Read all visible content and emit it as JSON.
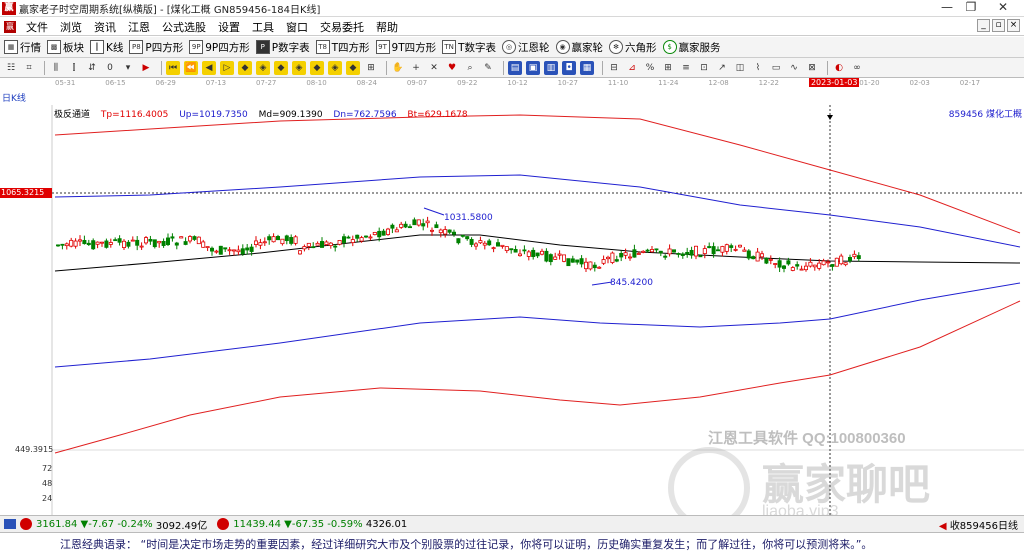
{
  "window": {
    "title": "赢家老子时空周期系统[纵横版] - [煤化工概  GN859456-184日K线]",
    "minimize": "—",
    "restore": "❐",
    "close": "✕"
  },
  "menu": {
    "items": [
      "文件",
      "浏览",
      "资讯",
      "江恩",
      "公式选股",
      "设置",
      "工具",
      "窗口",
      "交易委托",
      "帮助"
    ],
    "mdi": [
      "_",
      "▫",
      "×"
    ]
  },
  "toolbar1": {
    "items": [
      {
        "icon": "",
        "label": "行情"
      },
      {
        "icon": "",
        "label": "板块"
      },
      {
        "icon": "",
        "label": "K线"
      },
      {
        "icon": "P8",
        "label": "P四方形"
      },
      {
        "icon": "9P",
        "label": "9P四方形"
      },
      {
        "icon": "P",
        "label": "P数字表"
      },
      {
        "icon": "T8",
        "label": "T四方形"
      },
      {
        "icon": "9T",
        "label": "9T四方形"
      },
      {
        "icon": "TN",
        "label": "T数字表"
      },
      {
        "icon": "",
        "label": "江恩轮"
      },
      {
        "icon": "",
        "label": "赢家轮"
      },
      {
        "icon": "",
        "label": "六角形"
      },
      {
        "icon": "$",
        "label": "赢家服务"
      }
    ]
  },
  "toolbar2": {
    "icons": [
      "grid-icon",
      "chart-icon",
      "bar-icon",
      "candle-icon",
      "move-icon",
      "flag-icon",
      "first-icon",
      "back-icon",
      "prev-icon",
      "next-icon",
      "diamond-icon",
      "diamond-icon",
      "diamond-icon",
      "diamond-icon",
      "diamond-icon",
      "diamond-icon",
      "diamond-icon",
      "hand-icon",
      "cross-icon",
      "zoom-icon",
      "gift-icon",
      "pen-icon",
      "doc-icon",
      "save-icon",
      "print-icon",
      "camera-icon",
      "table-icon",
      "ruler-icon",
      "percent-icon",
      "calc-icon",
      "line-icon",
      "box-icon",
      "arrow-icon",
      "color-icon",
      "infinity-icon"
    ]
  },
  "date_axis": {
    "labels": [
      "05-31",
      "06-15",
      "06-29",
      "07-13",
      "07-27",
      "08-10",
      "08-24",
      "09-07",
      "09-22",
      "10-12",
      "10-27",
      "11-10",
      "11-24",
      "12-08",
      "12-22",
      "2023-01-03",
      "01-20",
      "02-03",
      "02-17"
    ],
    "highlight_index": 15,
    "period": "日K线"
  },
  "indicator": {
    "name": "极反通道",
    "tp": "Tp=1116.4005",
    "up": "Up=1019.7350",
    "md": "Md=909.1390",
    "dn": "Dn=762.7596",
    "bt": "Bt=629.1678"
  },
  "stock_label": "859456  煤化工概",
  "price_axis": {
    "crosshair_price": "1065.3215",
    "low_price": "449.3915",
    "volume_ticks": [
      "72",
      "48",
      "24"
    ]
  },
  "annotations": {
    "high": "1031.5800",
    "low": "845.4200"
  },
  "watermark": {
    "line1": "江恩工具软件  QQ:100800360",
    "line2": "赢家聊吧",
    "line3": "liaoba.vip3"
  },
  "statusbar": {
    "sh": {
      "value": "3161.84",
      "change": "▼-7.67",
      "pct": "-0.24%",
      "amount": "3092.49亿"
    },
    "sz": {
      "value": "11439.44",
      "change": "▼-67.35",
      "pct": "-0.59%",
      "amount": "4326.01"
    },
    "right": "收859456日线"
  },
  "quote": "江恩经典语录：  “时间是决定市场走势的重要因素，经过详细研究大市及个别股票的过往记录，你将可以证明，历史确实重复发生；而了解过往，你将可以预测将来。”。"
}
